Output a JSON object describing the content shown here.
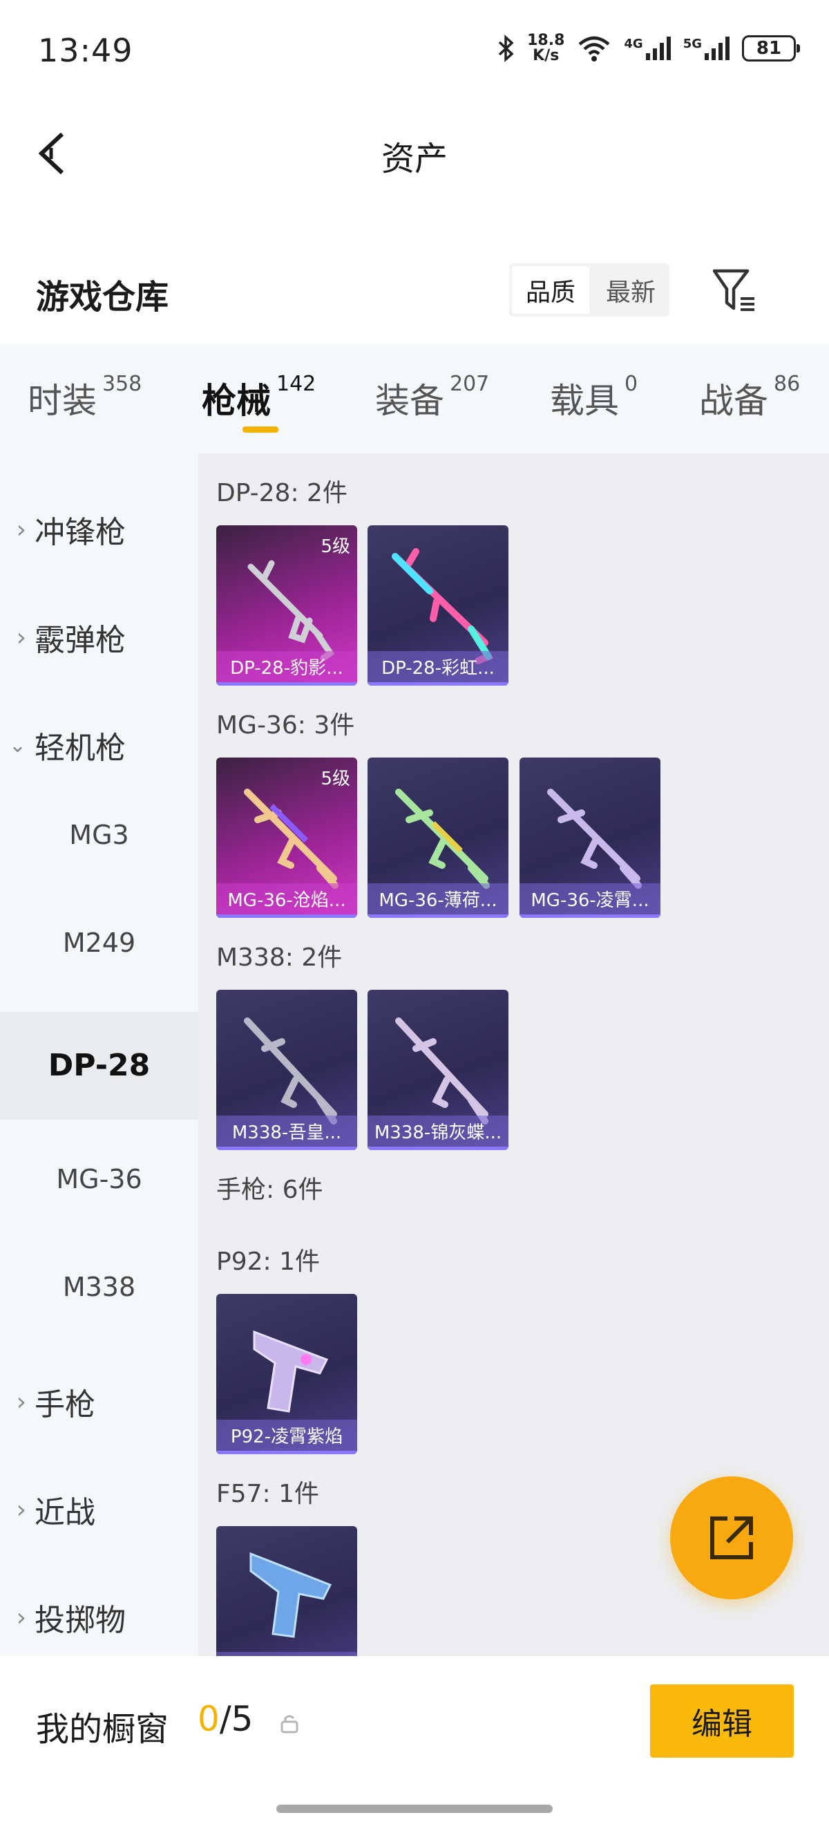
{
  "status_bar": {
    "time": "13:49",
    "net_speed_top": "18.8",
    "net_speed_bottom": "K/s",
    "net1": "4G",
    "net2": "5G",
    "battery": "81"
  },
  "header": {
    "title": "资产"
  },
  "warehouse": {
    "title": "游戏仓库",
    "sort_options": [
      "品质",
      "最新"
    ],
    "active_sort": "品质"
  },
  "tabs": [
    {
      "label": "时装",
      "count": "358"
    },
    {
      "label": "枪械",
      "count": "142"
    },
    {
      "label": "装备",
      "count": "207"
    },
    {
      "label": "载具",
      "count": "0"
    },
    {
      "label": "战备",
      "count": "86"
    }
  ],
  "sidebar": {
    "items": [
      "冲锋枪",
      "霰弹枪",
      "轻机枪",
      "手枪",
      "近战",
      "投掷物"
    ],
    "sub_items": [
      "MG3",
      "M249",
      "DP-28",
      "MG-36",
      "M338"
    ],
    "selected": "DP-28"
  },
  "content": {
    "groups": [
      {
        "label": "DP-28: 2件",
        "cards": [
          {
            "name": "DP-28-豹影...",
            "level": "5级",
            "style": "pink"
          },
          {
            "name": "DP-28-彩虹...",
            "level": "",
            "style": "purple"
          }
        ]
      },
      {
        "label": "MG-36: 3件",
        "cards": [
          {
            "name": "MG-36-沧焰...",
            "level": "5级",
            "style": "pink"
          },
          {
            "name": "MG-36-薄荷...",
            "level": "",
            "style": "purple"
          },
          {
            "name": "MG-36-凌霄...",
            "level": "",
            "style": "purple"
          }
        ]
      },
      {
        "label": "M338: 2件",
        "cards": [
          {
            "name": "M338-吾皇...",
            "level": "",
            "style": "purple"
          },
          {
            "name": "M338-锦灰蝶...",
            "level": "",
            "style": "purple"
          }
        ]
      }
    ],
    "section_label": "手枪: 6件",
    "pistol_groups": [
      {
        "label": "P92: 1件",
        "cards": [
          {
            "name": "P92-凌霄紫焰",
            "level": "",
            "style": "purple"
          }
        ]
      },
      {
        "label": "F57: 1件",
        "cards": [
          {
            "name": "",
            "level": "",
            "style": "purple"
          }
        ]
      }
    ]
  },
  "bottom_bar": {
    "label": "我的橱窗",
    "current": "0",
    "total": "/5",
    "edit_label": "编辑"
  },
  "colors": {
    "accent": "#f5b301",
    "sidebar_bg": "#f5f8fb",
    "content_bg": "#eceef1"
  }
}
